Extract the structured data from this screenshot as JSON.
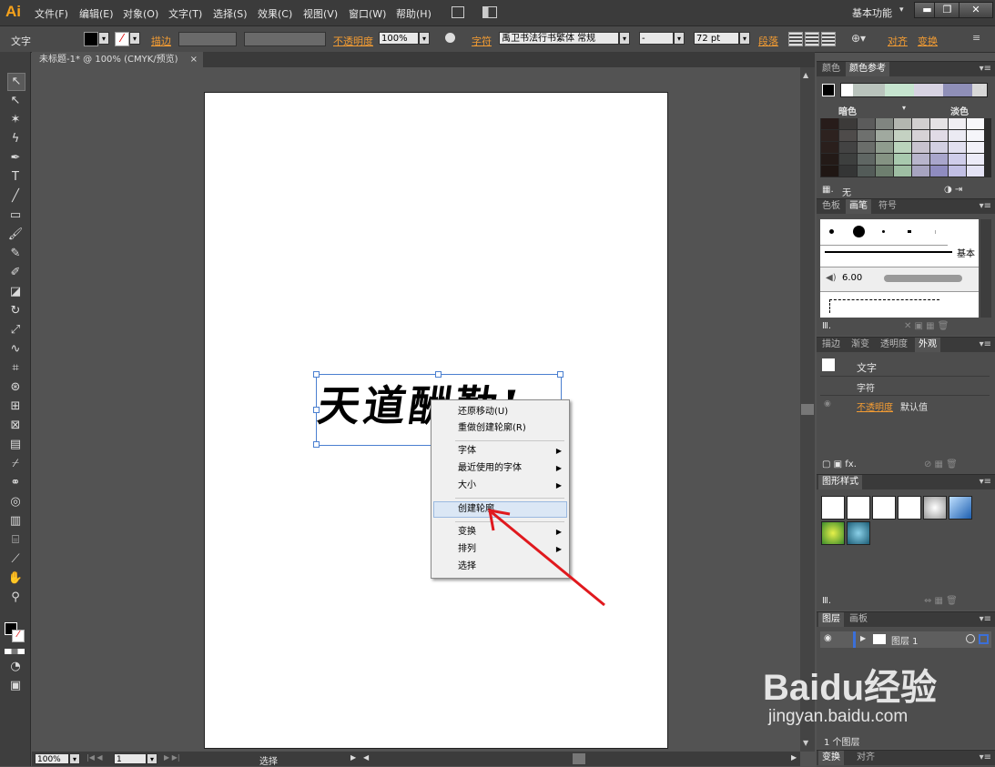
{
  "app": {
    "logo": "Ai"
  },
  "menubar": {
    "items": [
      "文件(F)",
      "编辑(E)",
      "对象(O)",
      "文字(T)",
      "选择(S)",
      "效果(C)",
      "视图(V)",
      "窗口(W)",
      "帮助(H)"
    ],
    "workspace": "基本功能",
    "minimize": "▬",
    "restore": "❐",
    "close": "✕"
  },
  "control_bar": {
    "tool_label": "文字",
    "stroke_label": "描边",
    "opacity_label": "不透明度",
    "opacity_value": "100%",
    "char_label": "字符",
    "font_family": "禹卫书法行书繁体 常规",
    "font_style": "-",
    "font_size": "72 pt",
    "paragraph_label": "段落",
    "align_label": "对齐",
    "transform_label": "变换"
  },
  "document": {
    "tab_title": "未标题-1* @ 100% (CMYK/预览)",
    "tab_close": "×",
    "artwork_text": "天道酬勤!"
  },
  "context_menu": {
    "items": [
      {
        "label": "还原移动(U)",
        "submenu": false
      },
      {
        "label": "重做创建轮廓(R)",
        "submenu": false
      },
      {
        "label": "字体",
        "submenu": true
      },
      {
        "label": "最近使用的字体",
        "submenu": true
      },
      {
        "label": "大小",
        "submenu": true
      },
      {
        "label": "创建轮廓",
        "submenu": false,
        "highlighted": true
      },
      {
        "label": "变换",
        "submenu": true
      },
      {
        "label": "排列",
        "submenu": true
      },
      {
        "label": "选择",
        "submenu": false
      }
    ]
  },
  "color_panel": {
    "tabs": [
      "颜色",
      "颜色参考"
    ],
    "dark_label": "暗色",
    "light_label": "淡色",
    "none_label": "无"
  },
  "brush_panel": {
    "tabs": [
      "色板",
      "画笔",
      "符号"
    ],
    "basic_label": "基本",
    "size_value": "6.00"
  },
  "appearance_panel": {
    "tabs": [
      "描边",
      "渐变",
      "透明度",
      "外观"
    ],
    "title": "文字",
    "char_row": "字符",
    "opacity_label": "不透明度",
    "opacity_value": "默认值"
  },
  "graphic_styles": {
    "tabs": [
      "图形样式"
    ]
  },
  "layers_panel": {
    "tabs": [
      "图层",
      "画板"
    ],
    "layer_name": "图层 1",
    "count": "1 个图层"
  },
  "bottom_panel": {
    "tabs": [
      "变换",
      "对齐"
    ]
  },
  "status_bar": {
    "zoom": "100%",
    "page": "1",
    "tool": "选择"
  },
  "watermark": {
    "brand": "Baidu经验",
    "url": "jingyan.baidu.com"
  },
  "colors": {
    "accent": "#f39c33",
    "annotation": "#e0191e",
    "selection": "#4a7fd0"
  }
}
